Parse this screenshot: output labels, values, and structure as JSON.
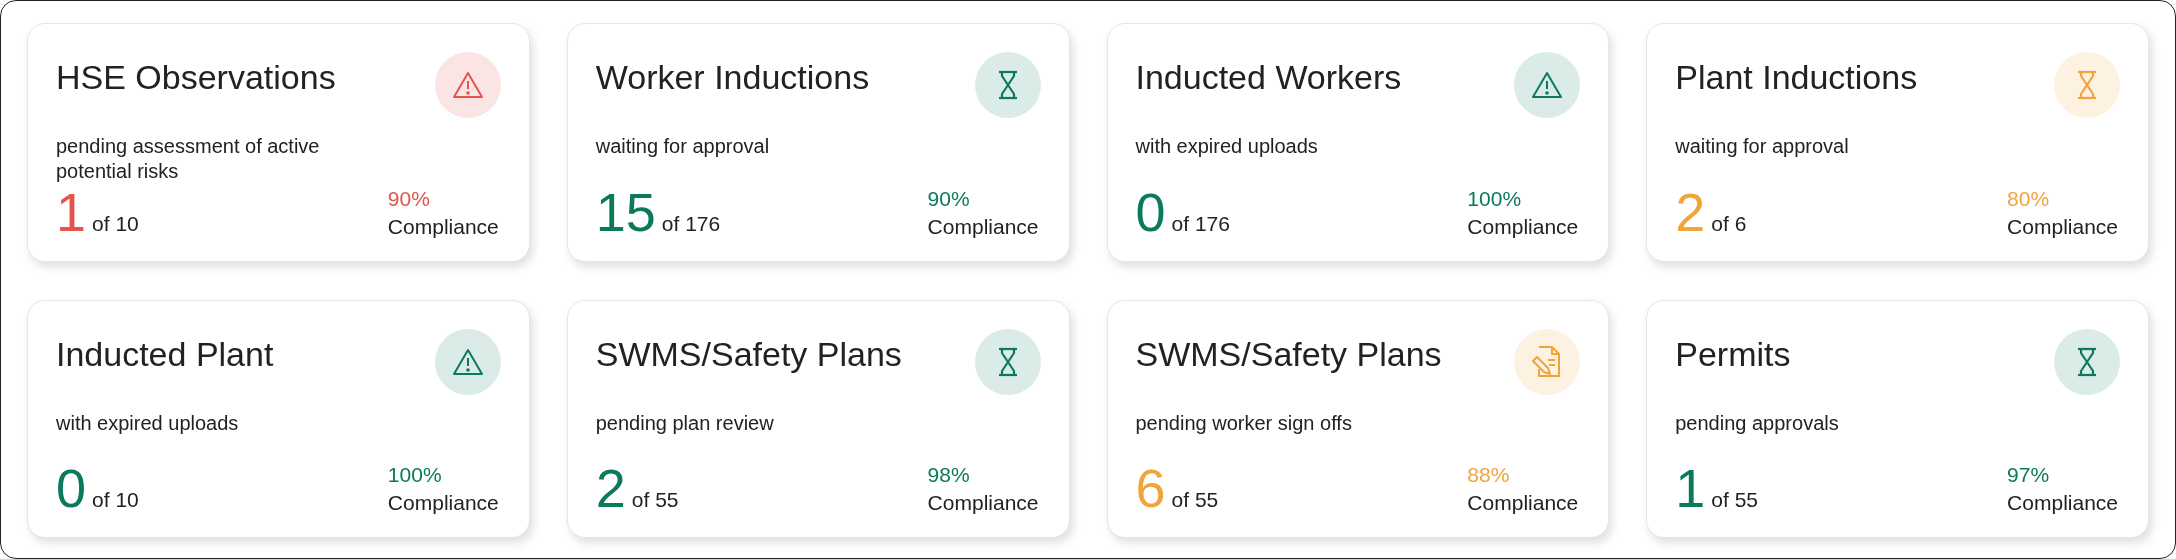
{
  "cards": [
    {
      "title": "HSE Observations",
      "subtitle": "pending assessment of active potential risks",
      "kind": "warning",
      "color": "#e5534b",
      "count": "1",
      "total": "of 10",
      "percent": "90%",
      "percent_label": "Compliance"
    },
    {
      "title": "Worker Inductions",
      "subtitle": "waiting for approval",
      "kind": "hourglass",
      "color": "#0b7a5c",
      "count": "15",
      "total": "of 176",
      "percent": "90%",
      "percent_label": "Compliance"
    },
    {
      "title": "Inducted Workers",
      "subtitle": "with expired uploads",
      "kind": "warning",
      "color": "#0b7a5c",
      "count": "0",
      "total": "of 176",
      "percent": "100%",
      "percent_label": "Compliance"
    },
    {
      "title": "Plant Inductions",
      "subtitle": "waiting for approval",
      "kind": "hourglass",
      "color": "#f0a43a",
      "count": "2",
      "total": "of 6",
      "percent": "80%",
      "percent_label": "Compliance"
    },
    {
      "title": "Inducted Plant",
      "subtitle": "with expired uploads",
      "kind": "warning",
      "color": "#0b7a5c",
      "count": "0",
      "total": "of 10",
      "percent": "100%",
      "percent_label": "Compliance"
    },
    {
      "title": "SWMS/Safety Plans",
      "subtitle": "pending plan review",
      "kind": "hourglass",
      "color": "#0b7a5c",
      "count": "2",
      "total": "of 55",
      "percent": "98%",
      "percent_label": "Compliance"
    },
    {
      "title": "SWMS/Safety Plans",
      "subtitle": "pending worker sign offs",
      "kind": "document",
      "color": "#f0a43a",
      "count": "6",
      "total": "of 55",
      "percent": "88%",
      "percent_label": "Compliance"
    },
    {
      "title": "Permits",
      "subtitle": "pending approvals",
      "kind": "hourglass",
      "color": "#0b7a5c",
      "count": "1",
      "total": "of 55",
      "percent": "97%",
      "percent_label": "Compliance"
    }
  ]
}
